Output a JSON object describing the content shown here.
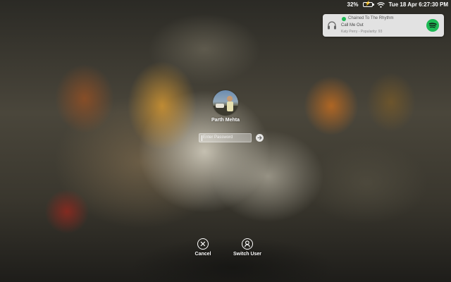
{
  "menubar": {
    "battery_percent": "32%",
    "datetime": "Tue 18 Apr  6:27:30 PM"
  },
  "notification": {
    "title": "Chained To The Rhythm",
    "song": "Call Me Out",
    "meta": "Katy Perry - Popularity: 93",
    "brand_color": "#1db954"
  },
  "login": {
    "user_name": "Parth Mehta",
    "password_placeholder": "Enter Password"
  },
  "actions": {
    "cancel_label": "Cancel",
    "switch_user_label": "Switch User"
  }
}
